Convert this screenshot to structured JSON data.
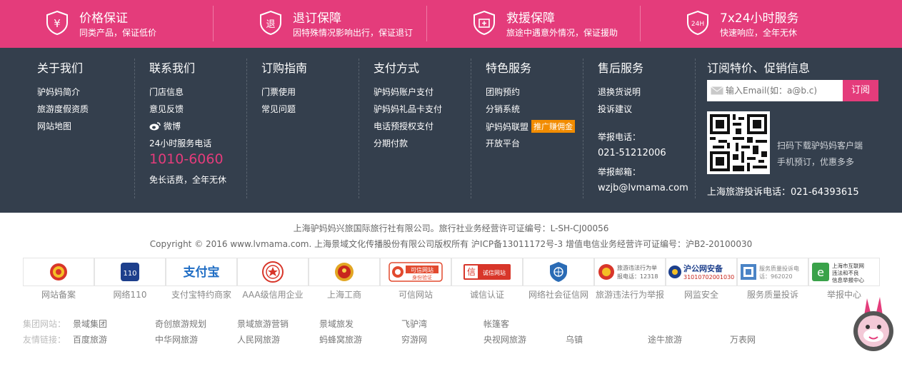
{
  "guarantees": [
    {
      "title": "价格保证",
      "sub": "同类产品，保证低价",
      "icon": "yuan-shield-icon"
    },
    {
      "title": "退订保障",
      "sub": "因特殊情况影响出行，保证退订",
      "icon": "refund-shield-icon"
    },
    {
      "title": "救援保障",
      "sub": "旅途中遇意外情况，保证援助",
      "icon": "first-aid-shield-icon"
    },
    {
      "title": "7x24小时服务",
      "sub": "快速响应，全年无休",
      "icon": "24h-shield-icon"
    }
  ],
  "about": {
    "title": "关于我们",
    "links": [
      "驴妈妈简介",
      "旅游度假资质",
      "网站地图"
    ]
  },
  "contact": {
    "title": "联系我们",
    "links": [
      "门店信息",
      "意见反馈"
    ],
    "weibo": "微博",
    "hotline_label": "24小时服务电话",
    "hotline": "1010-6060",
    "hotline_note": "免长话费，全年无休"
  },
  "guide": {
    "title": "订购指南",
    "links": [
      "门票使用",
      "常见问题"
    ]
  },
  "payment": {
    "title": "支付方式",
    "links": [
      "驴妈妈账户支付",
      "驴妈妈礼品卡支付",
      "电话预授权支付",
      "分期付款"
    ]
  },
  "special": {
    "title": "特色服务",
    "links": [
      "团购预约",
      "分销系统",
      "驴妈妈联盟",
      "开放平台"
    ],
    "tag": "推广赚佣金"
  },
  "aftersale": {
    "title": "售后服务",
    "links": [
      "退换货说明",
      "投诉建议"
    ],
    "report_phone_label": "举报电话：",
    "report_phone": "021-51212006",
    "report_email_label": "举报邮箱：",
    "report_email": "wzjb@lvmama.com"
  },
  "subscribe": {
    "title": "订阅特价、促销信息",
    "placeholder": "输入Email(如：a@b.c)",
    "button": "订阅",
    "qr_line1": "扫码下载驴妈妈客户端",
    "qr_line2": "手机预订，优惠多多",
    "complaint": "上海旅游投诉电话：021-64393615"
  },
  "copyright": {
    "line1": "上海驴妈妈兴旅国际旅行社有限公司。旅行社业务经营许可证编号：L-SH-CJ00056",
    "line2": "Copyright © 2016 www.lvmama.com. 上海景域文化传播股份有限公司版权所有    沪ICP备13011172号-3    增值电信业务经营许可证编号：沪B2-20100030"
  },
  "badges": [
    {
      "label": "网站备案",
      "icon": "police-emblem-icon"
    },
    {
      "label": "网络110",
      "icon": "police-110-icon",
      "text": "110"
    },
    {
      "label": "支付宝特约商家",
      "icon": "alipay-logo-icon",
      "text": "支付宝"
    },
    {
      "label": "AAA级信用企业",
      "icon": "credit-seal-icon"
    },
    {
      "label": "上海工商",
      "icon": "national-emblem-icon"
    },
    {
      "label": "可信网站",
      "icon": "trusted-site-icon",
      "text": "可信网站",
      "text2": "身份验证"
    },
    {
      "label": "诚信认证",
      "icon": "integrity-cert-icon",
      "text": "诚信网站"
    },
    {
      "label": "网络社会征信网",
      "icon": "globe-shield-icon"
    },
    {
      "label": "旅游违法行为举报",
      "icon": "tourism-report-icon",
      "text": "旅游违法行为举",
      "text2": "报电话：12318"
    },
    {
      "label": "网监安全",
      "icon": "net-police-icon",
      "text": "沪公网安备",
      "text2": "31010702001030"
    },
    {
      "label": "服务质量投诉",
      "icon": "service-complaint-icon",
      "text": "服务质量投诉电",
      "text2": "话：962020"
    },
    {
      "label": "举报中心",
      "icon": "report-center-icon",
      "text": "上海市互联网",
      "text2": "违法和不良",
      "text3": "信息举报中心"
    }
  ],
  "group_sites": {
    "label": "集团网站：",
    "items": [
      "景域集团",
      "奇创旅游规划",
      "景域旅游营销",
      "景域旅发",
      "飞驴湾",
      "帐篷客"
    ]
  },
  "friend_links": {
    "label": "友情链接：",
    "items": [
      "百度旅游",
      "中华网旅游",
      "人民网旅游",
      "蚂蜂窝旅游",
      "穷游网",
      "央视网旅游",
      "乌镇",
      "途牛旅游",
      "万表网"
    ]
  },
  "colors": {
    "pink": "#e43c7b",
    "dark": "#343f4d",
    "orange": "#f28c00"
  }
}
